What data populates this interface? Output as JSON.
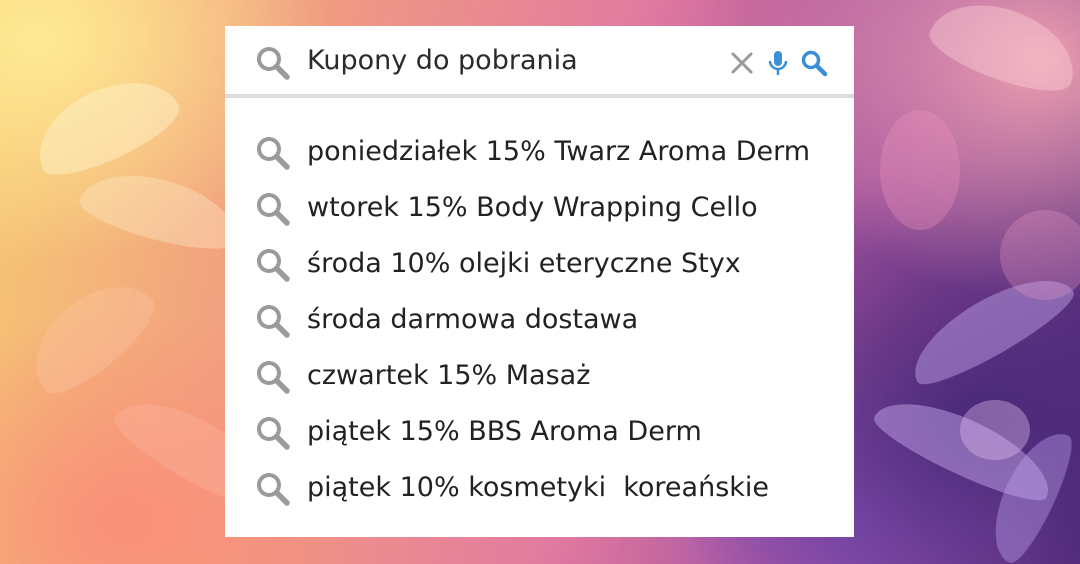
{
  "search": {
    "query": "Kupony do pobrania",
    "icons": {
      "lead": "search-icon",
      "clear": "close-icon",
      "voice": "microphone-icon",
      "submit": "search-icon"
    }
  },
  "suggestions": [
    {
      "text": "poniedziałek 15% Twarz Aroma Derm"
    },
    {
      "text": "wtorek 15% Body Wrapping Cello"
    },
    {
      "text": "środa 10% olejki eteryczne Styx"
    },
    {
      "text": "środa darmowa dostawa"
    },
    {
      "text": "czwartek 15% Masaż"
    },
    {
      "text": "piątek 15% BBS Aroma Derm"
    },
    {
      "text": "piątek 10% kosmetyki  koreańskie"
    }
  ],
  "colors": {
    "icon_gray": "#9a9a9a",
    "accent_blue": "#3a8fd6",
    "divider": "#dcdcdc",
    "text": "#222222"
  }
}
